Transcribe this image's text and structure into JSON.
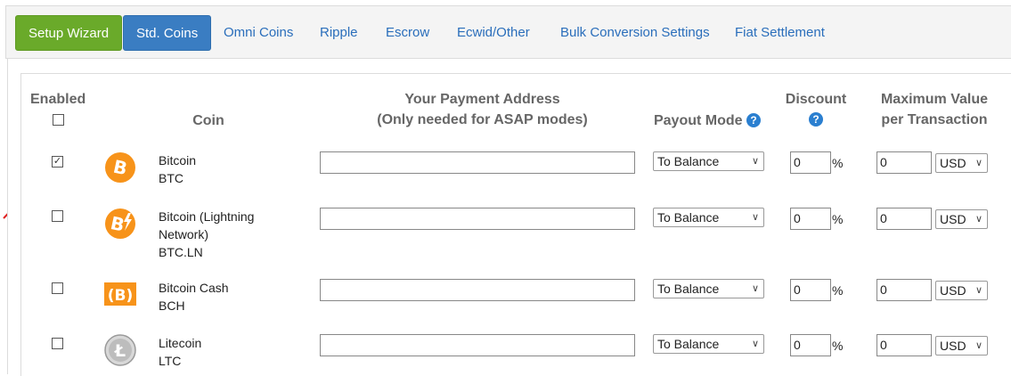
{
  "tabs": [
    {
      "label": "Setup Wizard"
    },
    {
      "label": "Std. Coins"
    },
    {
      "label": "Omni Coins"
    },
    {
      "label": "Ripple"
    },
    {
      "label": "Escrow"
    },
    {
      "label": "Ecwid/Other"
    },
    {
      "label": "Bulk Conversion Settings"
    },
    {
      "label": "Fiat Settlement"
    }
  ],
  "headers": {
    "enabled": "Enabled",
    "coin": "Coin",
    "address_line1": "Your Payment Address",
    "address_line2": "(Only needed for ASAP modes)",
    "payout": "Payout Mode",
    "discount": "Discount",
    "max_line1": "Maximum Value",
    "max_line2": "per Transaction",
    "help_glyph": "?"
  },
  "header_enabled_checked": false,
  "rows": [
    {
      "name_line1": "Bitcoin",
      "name_line2": "",
      "ticker": "BTC",
      "enabled": true,
      "check": "✓",
      "address": "",
      "payout_mode": "To Balance",
      "discount": "0",
      "percent": "%",
      "max_value": "0",
      "currency": "USD",
      "icon": "bitcoin-icon"
    },
    {
      "name_line1": "Bitcoin (Lightning",
      "name_line2": "Network)",
      "ticker": "BTC.LN",
      "enabled": false,
      "check": "",
      "address": "",
      "payout_mode": "To Balance",
      "discount": "0",
      "percent": "%",
      "max_value": "0",
      "currency": "USD",
      "icon": "bitcoin-lightning-icon"
    },
    {
      "name_line1": "Bitcoin Cash",
      "name_line2": "",
      "ticker": "BCH",
      "enabled": false,
      "check": "",
      "address": "",
      "payout_mode": "To Balance",
      "discount": "0",
      "percent": "%",
      "max_value": "0",
      "currency": "USD",
      "icon": "bitcoin-cash-icon"
    },
    {
      "name_line1": "Litecoin",
      "name_line2": "",
      "ticker": "LTC",
      "enabled": false,
      "check": "",
      "address": "",
      "payout_mode": "To Balance",
      "discount": "0",
      "percent": "%",
      "max_value": "0",
      "currency": "USD",
      "icon": "litecoin-icon"
    }
  ],
  "colors": {
    "green_button": "#6aaa2a",
    "blue_button": "#3a7dc2",
    "link": "#2a6ebb",
    "bitcoin_orange": "#f7931a",
    "annotation_arrow": "#e02020"
  }
}
